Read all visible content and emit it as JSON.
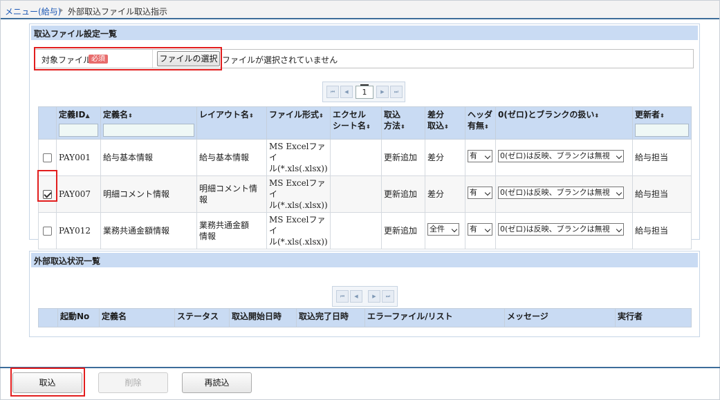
{
  "breadcrumb": {
    "parent": "メニュー(給与)",
    "current": "外部取込ファイル取込指示"
  },
  "settings_panel": {
    "title": "取込ファイル設定一覧",
    "file_label": "対象ファイル",
    "required_badge": "必須",
    "file_button": "ファイルの選択",
    "file_status": "ファイルが選択されていません",
    "pager": {
      "first": "⏮",
      "prev": "◀",
      "page": "1",
      "next": "▶",
      "last": "⏭"
    },
    "columns": [
      "",
      "定義ID",
      "定義名",
      "レイアウト名",
      "ファイル形式",
      "エクセル",
      "シート名",
      "取込",
      "方法",
      "差分",
      "取込",
      "ヘッダ",
      "有無",
      "0(ゼロ)とブランクの扱い",
      "更新者"
    ],
    "sort": {
      "asc": "▲",
      "both": "⬍"
    },
    "rows": [
      {
        "checked": false,
        "id": "PAY001",
        "name": "給与基本情報",
        "layout": "給与基本情報",
        "fmt1": "MS Excelファイ",
        "fmt2": "ル(*.xls(.xlsx))",
        "sheet": "",
        "method": "更新追加",
        "diff": "差分",
        "header": "有",
        "zero": "0(ゼロ)は反映、ブランクは無視",
        "updater": "給与担当"
      },
      {
        "checked": true,
        "id": "PAY007",
        "name": "明細コメント情報",
        "layout": "明細コメント情報",
        "fmt1": "MS Excelファイ",
        "fmt2": "ル(*.xls(.xlsx))",
        "sheet": "",
        "method": "更新追加",
        "diff": "差分",
        "header": "有",
        "zero": "0(ゼロ)は反映、ブランクは無視",
        "updater": "給与担当"
      },
      {
        "checked": false,
        "id": "PAY012",
        "name": "業務共通金額情報",
        "layout1": "業務共通金額",
        "layout2": "情報",
        "fmt1": "MS Excelファイ",
        "fmt2": "ル(*.xls(.xlsx))",
        "sheet": "",
        "method": "更新追加",
        "diff": "全件",
        "header": "有",
        "zero": "0(ゼロ)は反映、ブランクは無視",
        "updater": "給与担当"
      }
    ]
  },
  "status_panel": {
    "title": "外部取込状況一覧",
    "columns": [
      "",
      "起動No",
      "定義名",
      "ステータス",
      "取込開始日時",
      "取込完了日時",
      "エラーファイル/リスト",
      "メッセージ",
      "実行者"
    ]
  },
  "footer": {
    "import": "取込",
    "delete": "削除",
    "reload": "再読込"
  },
  "colors": {
    "accent": "#3d6d9a",
    "header_bg": "#c9dbf3",
    "highlight": "#e21d1d",
    "required": "#e86c6c"
  }
}
